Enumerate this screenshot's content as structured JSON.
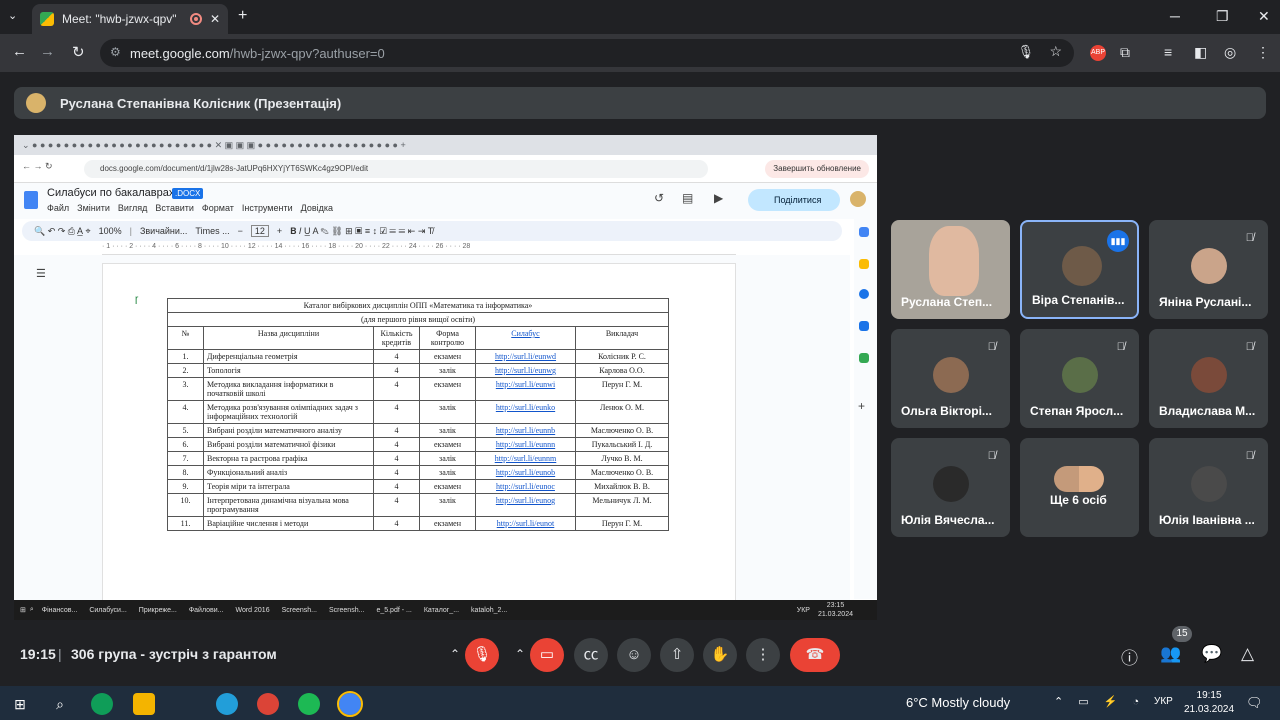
{
  "browser": {
    "tab_title": "Meet: \"hwb-jzwx-qpv\"",
    "new_tab": "+",
    "url_host": "meet.google.com",
    "url_rest": "/hwb-jzwx-qpv?authuser=0"
  },
  "presenter": {
    "label": "Руслана Степанівна Колісник (Презентація)"
  },
  "shared": {
    "inner_url": "docs.google.com/document/d/1jlw28s-JatUPq6HXYjYT6SWKc4gz9OPI/edit",
    "update_button": "Завершить обновление",
    "doc_title": "Силабуси по бакалаврах",
    "doc_badge": ".DOCX",
    "menus": [
      "Файл",
      "Змінити",
      "Вигляд",
      "Вставити",
      "Формат",
      "Інструменти",
      "Довідка"
    ],
    "share_button": "Поділитися",
    "toolbar": {
      "zoom": "100%",
      "style": "Звичайни...",
      "font": "Times ...",
      "size": "12"
    },
    "table": {
      "title": "Каталог вибіркових дисциплін ОПП «Математика та інформатика»",
      "subtitle": "(для першого рівня вищої освіти)",
      "headers": [
        "№",
        "Назва дисципліни",
        "Кількість кредитів",
        "Форма контролю",
        "Силабус",
        "Викладач"
      ],
      "rows": [
        [
          "1.",
          "Диференціальна геометрія",
          "4",
          "екзамен",
          "http://surl.li/eunwd",
          "Колісник Р. С."
        ],
        [
          "2.",
          "Топологія",
          "4",
          "залік",
          "http://surl.li/eunwg",
          "Карлова О.О."
        ],
        [
          "3.",
          "Методика викладання інформатики в початковій школі",
          "4",
          "екзамен",
          "http://surl.li/eunwi",
          "Перун Г. М."
        ],
        [
          "4.",
          "Методика розв'язування олімпіадних задач з інформаційних технологій",
          "4",
          "залік",
          "http://surl.li/eunko",
          "Ленюк О. М."
        ],
        [
          "5.",
          "Вибрані розділи математичного аналізу",
          "4",
          "залік",
          "http://surl.li/eunnb",
          "Маслюченко О. В."
        ],
        [
          "6.",
          "Вибрані розділи математичної фізики",
          "4",
          "екзамен",
          "http://surl.li/eunnn",
          "Пукальський І. Д."
        ],
        [
          "7.",
          "Векторна та растрова графіка",
          "4",
          "залік",
          "http://surl.li/eunnm",
          "Лучко В. М."
        ],
        [
          "8.",
          "Функціональний аналіз",
          "4",
          "залік",
          "http://surl.li/eunob",
          "Маслюченко О. В."
        ],
        [
          "9.",
          "Теорія міри та інтеграла",
          "4",
          "екзамен",
          "http://surl.li/eunoc",
          "Михайлюк В. В."
        ],
        [
          "10.",
          "Інтерпретована динамічна візуальна мова програмування",
          "4",
          "залік",
          "http://surl.li/eunog",
          "Мельничук Л. М."
        ],
        [
          "11.",
          "Варіаційне числення і методи",
          "4",
          "екзамен",
          "http://surl.li/eunot",
          "Перун Г. М."
        ]
      ]
    },
    "taskbar": [
      "Фінансов...",
      "Силабуси...",
      "Прикреже...",
      "Файлови...",
      "Word 2016",
      "Screensh...",
      "Screensh...",
      "e_5.pdf - ...",
      "Каталог_...",
      "kataloh_2..."
    ],
    "taskbar_lang": "УКР",
    "taskbar_time": "23:15",
    "taskbar_date": "21.03.2024"
  },
  "participants": [
    {
      "name": "Руслана Степ...",
      "muted": false
    },
    {
      "name": "Віра Степанів...",
      "muted": false,
      "speaking": true
    },
    {
      "name": "Яніна Руслані...",
      "muted": true
    },
    {
      "name": "Ольга Вікторі...",
      "muted": true
    },
    {
      "name": "Степан Яросл...",
      "muted": true
    },
    {
      "name": "Владислава М...",
      "muted": true
    },
    {
      "name": "Юлія Вячесла...",
      "muted": true
    },
    {
      "name": "Ще 6 осіб",
      "muted": false
    },
    {
      "name": "Юлія Іванівна ...",
      "muted": true
    }
  ],
  "bottom": {
    "time": "19:15",
    "meeting": "306 група - зустріч з гарантом",
    "participant_count": "15"
  },
  "windows": {
    "weather": "6°C  Mostly cloudy",
    "lang": "УКР",
    "time": "19:15",
    "date": "21.03.2024"
  }
}
